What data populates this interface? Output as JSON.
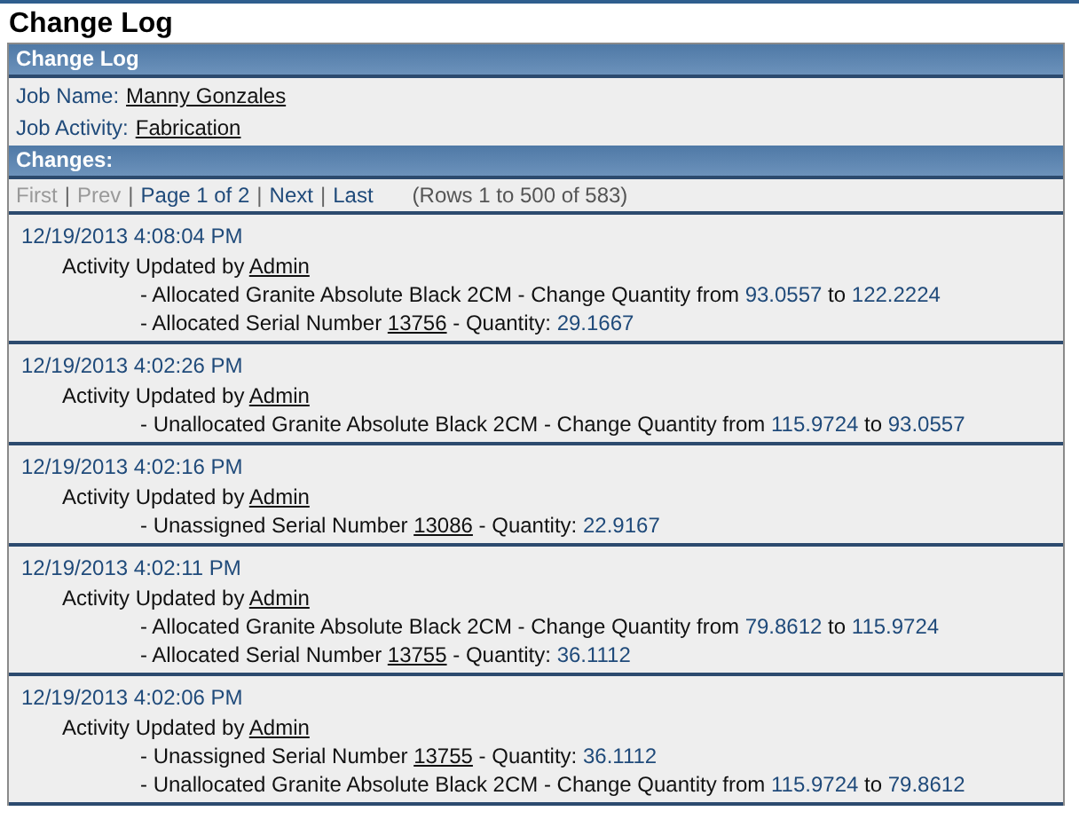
{
  "page_title": "Change Log",
  "panel": {
    "title": "Change Log",
    "fields": [
      {
        "label": "Job Name:",
        "value": "Manny Gonzales"
      },
      {
        "label": "Job Activity:",
        "value": "Fabrication"
      }
    ]
  },
  "changes": {
    "title": "Changes:",
    "pager": [
      {
        "kind": "link",
        "label": "First",
        "disabled": true
      },
      {
        "kind": "separator",
        "label": "|"
      },
      {
        "kind": "link",
        "label": "Prev",
        "disabled": true
      },
      {
        "kind": "separator",
        "label": "|"
      },
      {
        "kind": "link",
        "label": "Page 1 of 2",
        "disabled": false
      },
      {
        "kind": "separator",
        "label": "|"
      },
      {
        "kind": "link",
        "label": "Next",
        "disabled": false
      },
      {
        "kind": "separator",
        "label": "|"
      },
      {
        "kind": "link",
        "label": "Last",
        "disabled": false
      }
    ],
    "rows_info": "(Rows 1 to 500 of 583)",
    "entries": [
      {
        "time": "12/19/2013 4:08:04 PM",
        "activity": [
          {
            "kind": "plain",
            "text": "Activity Updated by "
          },
          {
            "kind": "link",
            "text": "Admin"
          }
        ],
        "details": [
          [
            {
              "kind": "plain",
              "text": "- Allocated Granite Absolute Black 2CM - Change Quantity from "
            },
            {
              "kind": "value",
              "text": "93.0557"
            },
            {
              "kind": "plain",
              "text": " to "
            },
            {
              "kind": "value",
              "text": "122.2224"
            }
          ],
          [
            {
              "kind": "plain",
              "text": "- Allocated Serial Number "
            },
            {
              "kind": "link",
              "text": "13756"
            },
            {
              "kind": "plain",
              "text": " - Quantity: "
            },
            {
              "kind": "value",
              "text": "29.1667"
            }
          ]
        ]
      },
      {
        "time": "12/19/2013 4:02:26 PM",
        "activity": [
          {
            "kind": "plain",
            "text": "Activity Updated by "
          },
          {
            "kind": "link",
            "text": "Admin"
          }
        ],
        "details": [
          [
            {
              "kind": "plain",
              "text": "- Unallocated Granite Absolute Black 2CM - Change Quantity from "
            },
            {
              "kind": "value",
              "text": "115.9724"
            },
            {
              "kind": "plain",
              "text": " to "
            },
            {
              "kind": "value",
              "text": "93.0557"
            }
          ]
        ]
      },
      {
        "time": "12/19/2013 4:02:16 PM",
        "activity": [
          {
            "kind": "plain",
            "text": "Activity Updated by "
          },
          {
            "kind": "link",
            "text": "Admin"
          }
        ],
        "details": [
          [
            {
              "kind": "plain",
              "text": "- Unassigned Serial Number "
            },
            {
              "kind": "link",
              "text": "13086"
            },
            {
              "kind": "plain",
              "text": " - Quantity: "
            },
            {
              "kind": "value",
              "text": "22.9167"
            }
          ]
        ]
      },
      {
        "time": "12/19/2013 4:02:11 PM",
        "activity": [
          {
            "kind": "plain",
            "text": "Activity Updated by "
          },
          {
            "kind": "link",
            "text": "Admin"
          }
        ],
        "details": [
          [
            {
              "kind": "plain",
              "text": "- Allocated Granite Absolute Black 2CM - Change Quantity from "
            },
            {
              "kind": "value",
              "text": "79.8612"
            },
            {
              "kind": "plain",
              "text": " to "
            },
            {
              "kind": "value",
              "text": "115.9724"
            }
          ],
          [
            {
              "kind": "plain",
              "text": "- Allocated Serial Number "
            },
            {
              "kind": "link",
              "text": "13755"
            },
            {
              "kind": "plain",
              "text": " - Quantity: "
            },
            {
              "kind": "value",
              "text": "36.1112"
            }
          ]
        ]
      },
      {
        "time": "12/19/2013 4:02:06 PM",
        "activity": [
          {
            "kind": "plain",
            "text": "Activity Updated by "
          },
          {
            "kind": "link",
            "text": "Admin"
          }
        ],
        "details": [
          [
            {
              "kind": "plain",
              "text": "- Unassigned Serial Number "
            },
            {
              "kind": "link",
              "text": "13755"
            },
            {
              "kind": "plain",
              "text": " - Quantity: "
            },
            {
              "kind": "value",
              "text": "36.1112"
            }
          ],
          [
            {
              "kind": "plain",
              "text": "- Unallocated Granite Absolute Black 2CM - Change Quantity from "
            },
            {
              "kind": "value",
              "text": "115.9724"
            },
            {
              "kind": "plain",
              "text": " to "
            },
            {
              "kind": "value",
              "text": "79.8612"
            }
          ]
        ]
      }
    ]
  }
}
